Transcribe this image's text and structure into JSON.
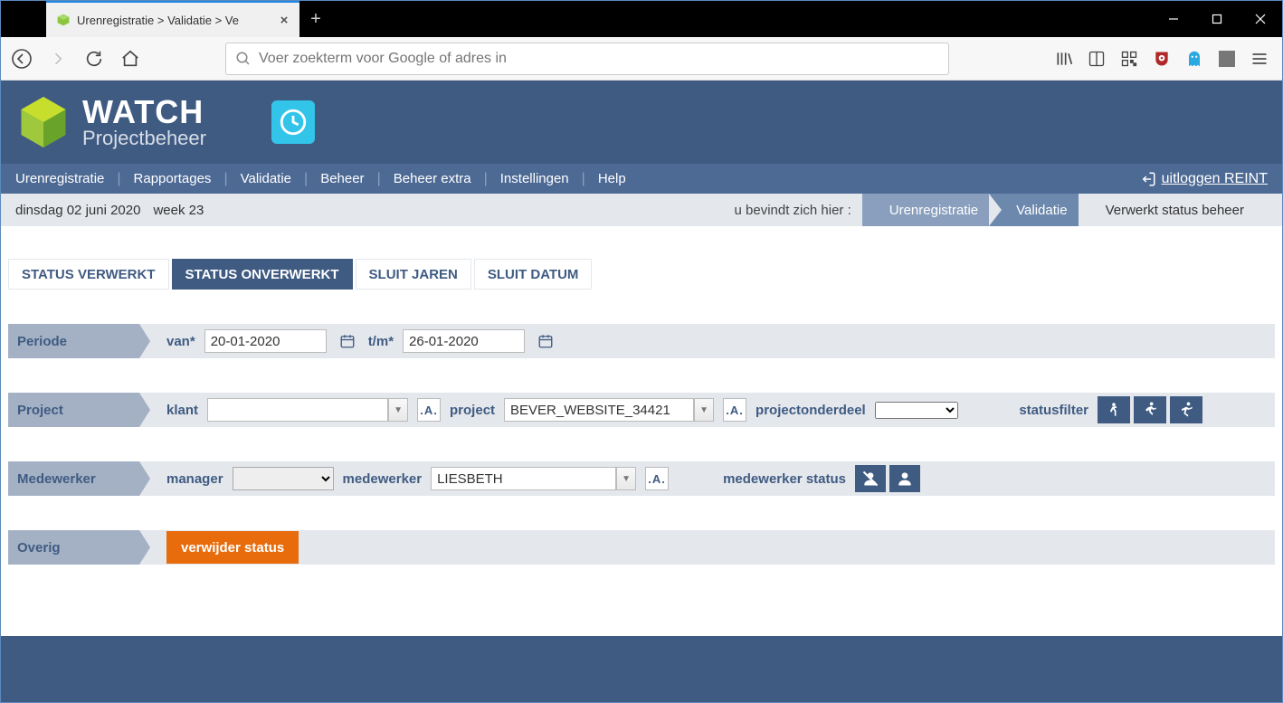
{
  "browser": {
    "tab_title": "Urenregistratie > Validatie > Ve",
    "url_placeholder": "Voer zoekterm voor Google of adres in"
  },
  "header": {
    "brand": "WATCH",
    "subtitle": "Projectbeheer"
  },
  "nav": {
    "items": [
      "Urenregistratie",
      "Rapportages",
      "Validatie",
      "Beheer",
      "Beheer extra",
      "Instellingen",
      "Help"
    ],
    "logout_label": "uitloggen REINT"
  },
  "infobar": {
    "date": "dinsdag 02 juni 2020",
    "week": "week 23",
    "here_label": "u bevindt zich hier :",
    "crumbs": [
      "Urenregistratie",
      "Validatie",
      "Verwerkt status beheer"
    ]
  },
  "tabs": {
    "items": [
      "STATUS VERWERKT",
      "STATUS ONVERWERKT",
      "SLUIT JAREN",
      "SLUIT DATUM"
    ],
    "active_index": 1
  },
  "form": {
    "periode": {
      "head": "Periode",
      "van_label": "van*",
      "van_value": "20-01-2020",
      "tm_label": "t/m*",
      "tm_value": "26-01-2020"
    },
    "project": {
      "head": "Project",
      "klant_label": "klant",
      "klant_value": "",
      "project_label": "project",
      "project_value": "BEVER_WEBSITE_34421",
      "onderdeel_label": "projectonderdeel",
      "statusfilter_label": "statusfilter"
    },
    "medewerker": {
      "head": "Medewerker",
      "manager_label": "manager",
      "medewerker_label": "medewerker",
      "medewerker_value": "LIESBETH",
      "status_label": "medewerker status"
    },
    "overig": {
      "head": "Overig",
      "remove_label": "verwijder status"
    },
    "a_label": ".A."
  }
}
